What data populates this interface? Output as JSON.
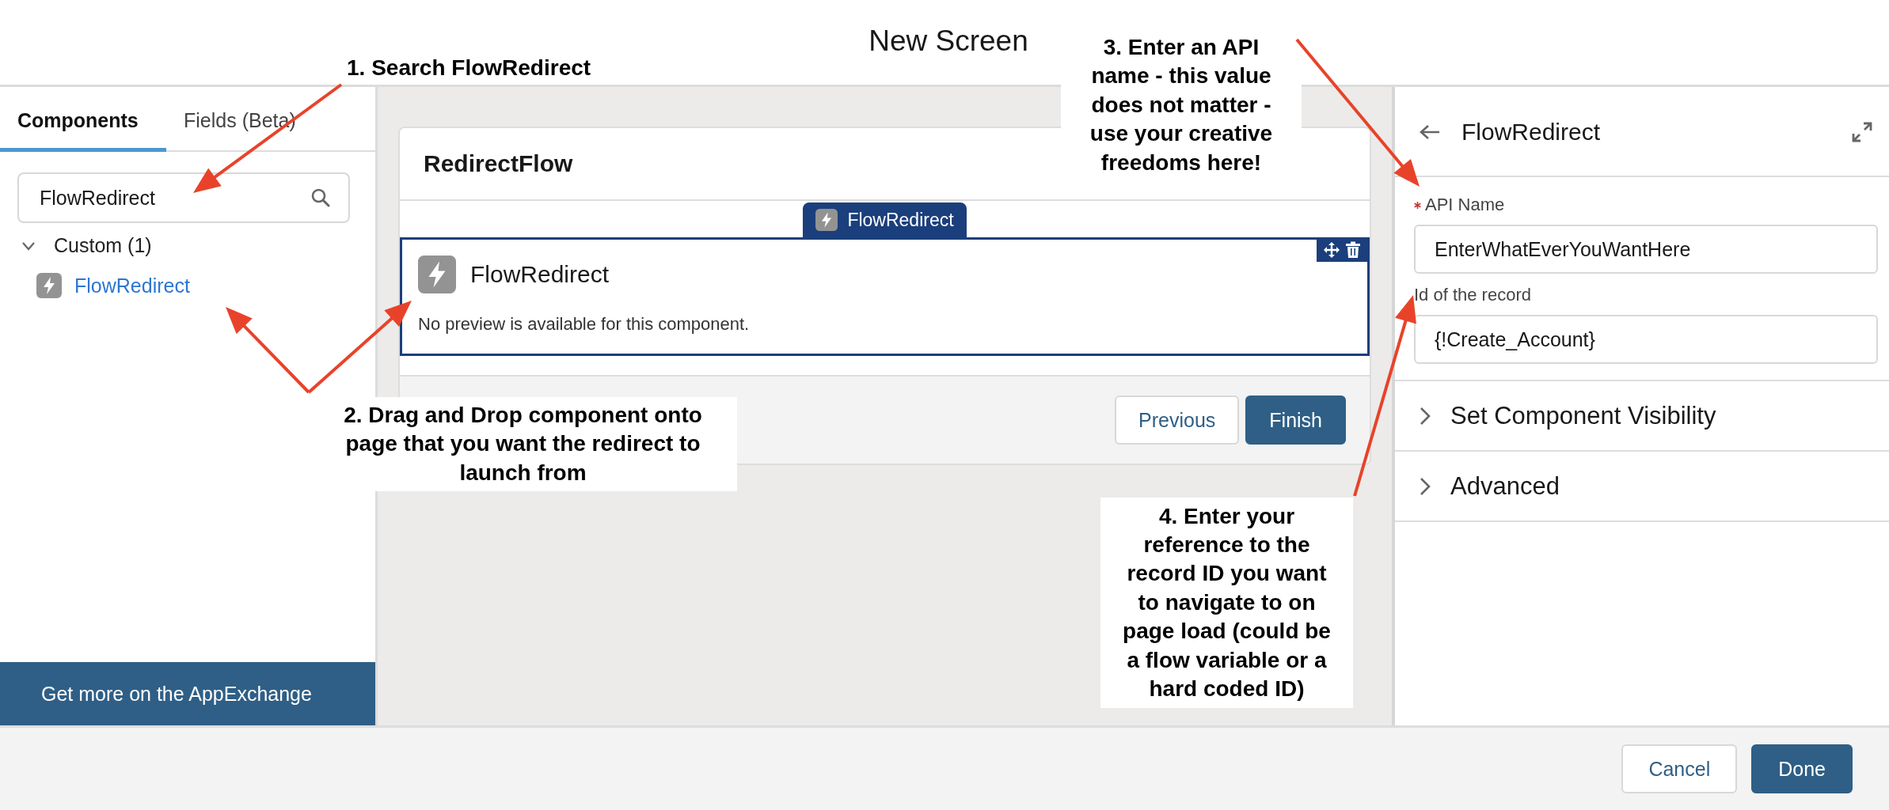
{
  "header": {
    "title": "New Screen"
  },
  "palette": {
    "tabs": [
      {
        "label": "Components",
        "selected": true
      },
      {
        "label": "Fields (Beta)",
        "selected": false
      }
    ],
    "search": {
      "value": "FlowRedirect"
    },
    "groups": [
      {
        "label": "Custom (1)",
        "expanded": true,
        "children": [
          {
            "label": "FlowRedirect"
          }
        ]
      }
    ],
    "footer_link": "Get more on the AppExchange"
  },
  "canvas": {
    "screen_title": "RedirectFlow",
    "component": {
      "tab_label": "FlowRedirect",
      "title": "FlowRedirect",
      "message": "No preview is available for this component.",
      "selected": true
    },
    "buttons": [
      {
        "label": "Previous",
        "kind": "secondary"
      },
      {
        "label": "Finish",
        "kind": "primary"
      }
    ]
  },
  "properties": {
    "title": "FlowRedirect",
    "fields": [
      {
        "label": "API Name",
        "required": true,
        "value": "EnterWhatEverYouWantHere"
      },
      {
        "label": "Id of the record",
        "required": false,
        "value": "{!Create_Account}"
      }
    ],
    "sections": [
      {
        "label": "Set Component Visibility",
        "expanded": false
      },
      {
        "label": "Advanced",
        "expanded": false
      }
    ]
  },
  "footer": {
    "buttons": [
      {
        "label": "Cancel",
        "kind": "secondary"
      },
      {
        "label": "Done",
        "kind": "primary"
      }
    ]
  },
  "annotations": [
    {
      "text": "1. Search FlowRedirect"
    },
    {
      "text": "2. Drag and Drop component onto page that you want the redirect to launch from"
    },
    {
      "text": "3. Enter an API name - this value does not matter - use your creative freedoms here!"
    },
    {
      "text": "4. Enter your reference to the record ID you want to navigate to on page load (could be a flow variable or a hard coded ID)"
    }
  ]
}
